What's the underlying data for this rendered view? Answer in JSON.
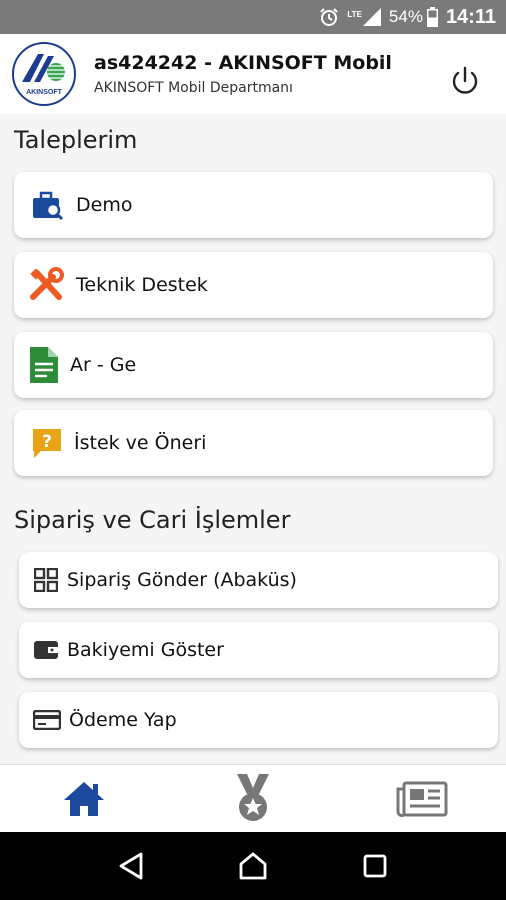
{
  "status_bar": {
    "battery": "54%",
    "time": "14:11",
    "network": "LTE"
  },
  "header": {
    "logo_text": "AKINSOFT",
    "title": "as424242 - AKINSOFT Mobil",
    "subtitle": "AKINSOFT Mobil Departmanı"
  },
  "taleplerim": {
    "title": "Taleplerim",
    "items": [
      {
        "label": "Demo",
        "icon": "briefcase-search-icon",
        "color": "#1c4a9c"
      },
      {
        "label": "Teknik Destek",
        "icon": "tools-icon",
        "color": "#ee5a24"
      },
      {
        "label": "Ar - Ge",
        "icon": "document-icon",
        "color": "#2e8b3a"
      },
      {
        "label": "İstek ve Öneri",
        "icon": "question-chat-icon",
        "color": "#e8a317"
      }
    ]
  },
  "siparis": {
    "title": "Sipariş ve Cari İşlemler",
    "items": [
      {
        "label": "Sipariş Gönder (Abaküs)",
        "icon": "grid-icon"
      },
      {
        "label": "Bakiyemi Göster",
        "icon": "wallet-icon"
      },
      {
        "label": "Ödeme Yap",
        "icon": "credit-card-icon"
      }
    ]
  },
  "bottom_nav": [
    {
      "icon": "home-icon",
      "color": "#1c4a9c",
      "active": true
    },
    {
      "icon": "medal-icon",
      "color": "#777777",
      "active": false
    },
    {
      "icon": "newspaper-icon",
      "color": "#777777",
      "active": false
    }
  ]
}
